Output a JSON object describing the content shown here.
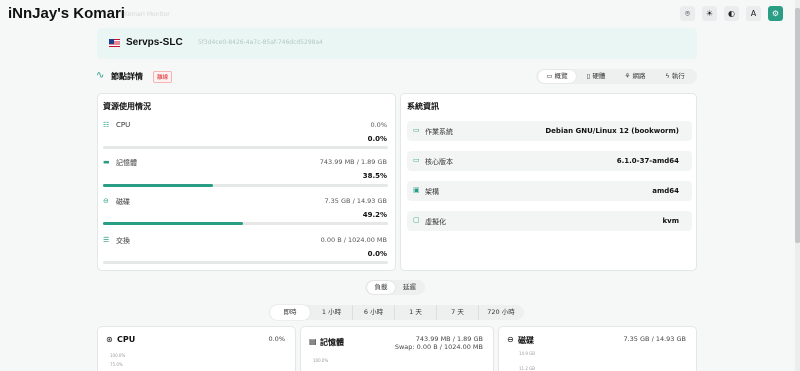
{
  "header": {
    "title": "iNnJay's Komari",
    "subtitle": "Komari Monitor",
    "buttons": [
      {
        "icon": "github-icon",
        "glyph": "⌾"
      },
      {
        "icon": "sun-icon",
        "glyph": "☀"
      },
      {
        "icon": "theme-icon",
        "glyph": "◐"
      },
      {
        "icon": "translate-icon",
        "glyph": "A"
      },
      {
        "icon": "settings-icon",
        "glyph": "⚙"
      }
    ]
  },
  "server": {
    "name": "Servps-SLC",
    "uuid": "5f3d4ce0-8426-4a7c-85af-746dcd5298a4"
  },
  "node": {
    "title": "節點詳情",
    "badge": "離線",
    "tabs": [
      {
        "label": "概覽",
        "glyph": "▭"
      },
      {
        "label": "硬體",
        "glyph": "▯"
      },
      {
        "label": "網路",
        "glyph": "⚘"
      },
      {
        "label": "執行",
        "glyph": "ϟ"
      }
    ]
  },
  "resources": {
    "title": "資源使用情況",
    "items": [
      {
        "label": "CPU",
        "value": "0.0%",
        "percent": "0.0%",
        "fill": 0.0
      },
      {
        "label": "記憶體",
        "value": "743.99 MB / 1.89 GB",
        "percent": "38.5%",
        "fill": 0.385
      },
      {
        "label": "磁碟",
        "value": "7.35 GB / 14.93 GB",
        "percent": "49.2%",
        "fill": 0.492
      },
      {
        "label": "交換",
        "value": "0.00 B / 1024.00 MB",
        "percent": "0.0%",
        "fill": 0.0
      }
    ]
  },
  "system": {
    "title": "系統資訊",
    "items": [
      {
        "label": "作業系統",
        "value": "Debian GNU/Linux 12 (bookworm)"
      },
      {
        "label": "核心版本",
        "value": "6.1.0-37-amd64"
      },
      {
        "label": "架構",
        "value": "amd64"
      },
      {
        "label": "虛擬化",
        "value": "kvm"
      }
    ]
  },
  "view_toggle": {
    "options": [
      "負載",
      "延遲"
    ],
    "active": "負載"
  },
  "time_range": {
    "options": [
      "即時",
      "1 小時",
      "6 小時",
      "1 天",
      "7 天",
      "720 小時"
    ],
    "active": "即時"
  },
  "charts": {
    "cpu": {
      "title": "CPU",
      "value": "0.0%",
      "ticks": [
        "100.0%",
        "75.0%"
      ]
    },
    "memory": {
      "title": "記憶體",
      "line1": "743.99 MB / 1.89 GB",
      "line2": "Swap: 0.00 B / 1024.00 MB",
      "ticks": [
        "100.0%"
      ]
    },
    "disk": {
      "title": "磁碟",
      "value": "7.35 GB / 14.93 GB",
      "ticks": [
        "14.9 GB",
        "11.2 GB"
      ]
    }
  },
  "colors": {
    "accent": "#2a9d85",
    "danger": "#dc2626"
  }
}
